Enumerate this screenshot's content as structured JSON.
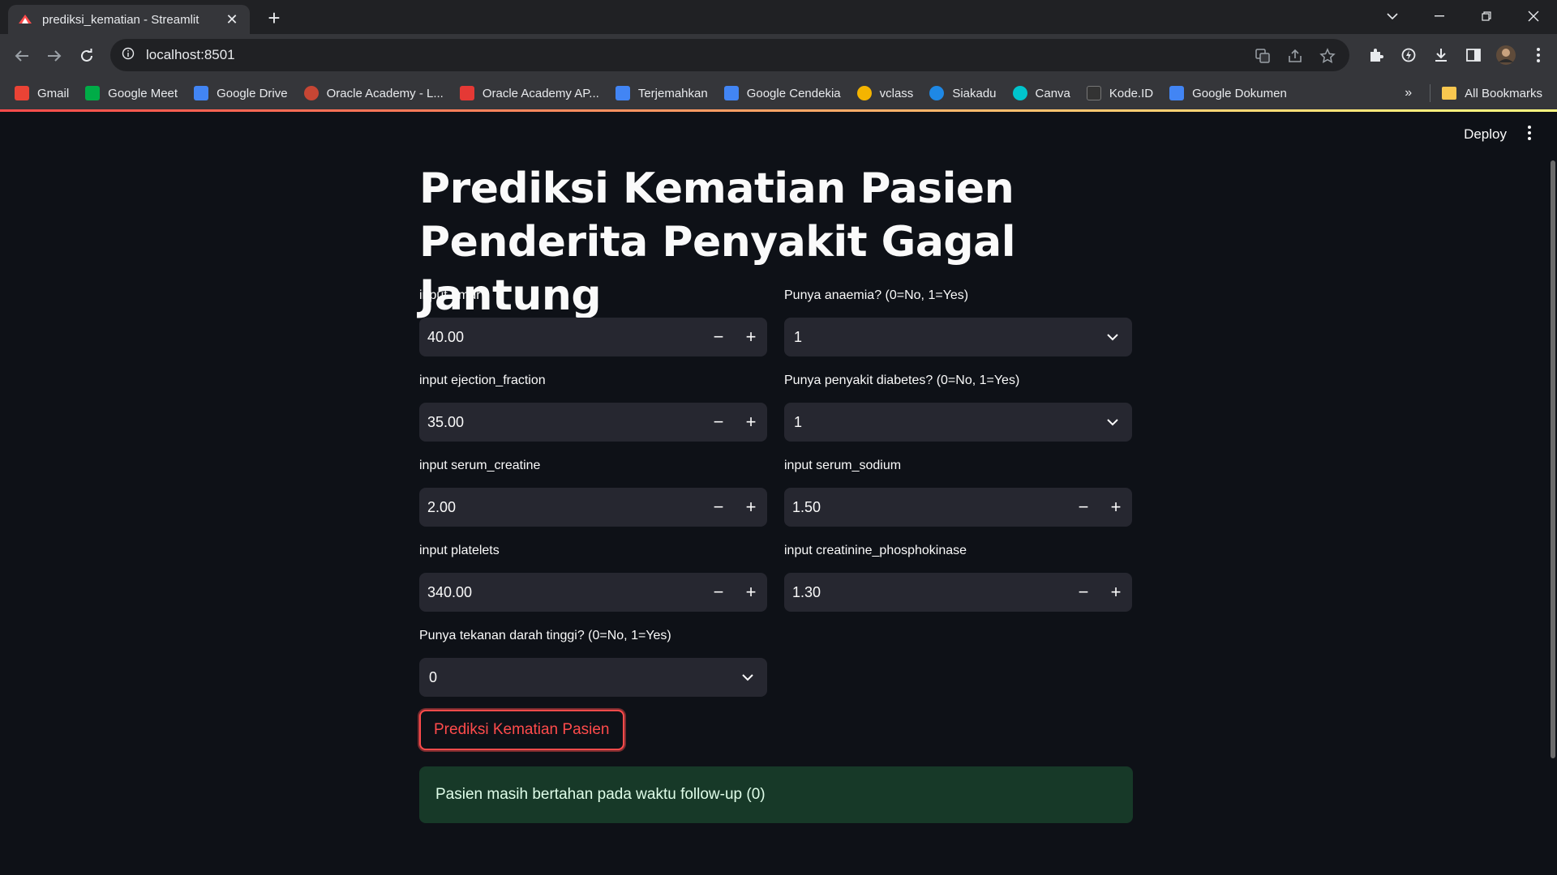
{
  "browser": {
    "tab_title": "prediksi_kematian - Streamlit",
    "url": "localhost:8501",
    "bookmarks": [
      {
        "label": "Gmail",
        "color": "#ea4335"
      },
      {
        "label": "Google Meet",
        "color": "#00ac47"
      },
      {
        "label": "Google Drive",
        "color": "#4285f4"
      },
      {
        "label": "Oracle Academy - L...",
        "color": "#c74634"
      },
      {
        "label": "Oracle Academy AP...",
        "color": "#e53935"
      },
      {
        "label": "Terjemahkan",
        "color": "#4285f4"
      },
      {
        "label": "Google Cendekia",
        "color": "#4285f4"
      },
      {
        "label": "vclass",
        "color": "#f4b400"
      },
      {
        "label": "Siakadu",
        "color": "#1e88e5"
      },
      {
        "label": "Canva",
        "color": "#00c4cc"
      },
      {
        "label": "Kode.ID",
        "color": "#333333"
      },
      {
        "label": "Google Dokumen",
        "color": "#4285f4"
      }
    ],
    "all_bookmarks_label": "All Bookmarks"
  },
  "app": {
    "deploy_label": "Deploy",
    "title": "Prediksi Kematian Pasien Penderita Penyakit Gagal Jantung",
    "fields": {
      "umur": {
        "label": "input umur",
        "value": "40.00"
      },
      "anaemia": {
        "label": "Punya anaemia? (0=No, 1=Yes)",
        "value": "1"
      },
      "ejection_fraction": {
        "label": "input ejection_fraction",
        "value": "35.00"
      },
      "diabetes": {
        "label": "Punya penyakit diabetes? (0=No, 1=Yes)",
        "value": "1"
      },
      "serum_creatine": {
        "label": "input serum_creatine",
        "value": "2.00"
      },
      "serum_sodium": {
        "label": "input serum_sodium",
        "value": "1.50"
      },
      "platelets": {
        "label": "input platelets",
        "value": "340.00"
      },
      "creatinine_phosphokinase": {
        "label": "input creatinine_phosphokinase",
        "value": "1.30"
      },
      "tekanan_darah": {
        "label": "Punya tekanan darah tinggi? (0=No, 1=Yes)",
        "value": "0"
      }
    },
    "predict_button": "Prediksi Kematian Pasien",
    "result": "Pasien masih bertahan pada waktu follow-up (0)",
    "colors": {
      "primary": "#ff4b4b",
      "success_bg": "#173928",
      "input_bg": "#262730",
      "background": "#0e1117"
    }
  }
}
